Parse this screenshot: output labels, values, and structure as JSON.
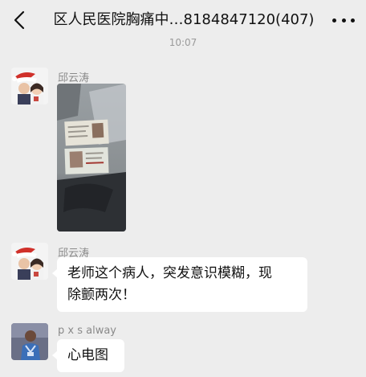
{
  "header": {
    "title": "区人民医院胸痛中…8184847120(407)"
  },
  "chat": {
    "timestamp": "10:07",
    "messages": [
      {
        "sender": "邱云涛",
        "type": "image"
      },
      {
        "sender": "邱云涛",
        "type": "text",
        "text_line1": "老师这个病人，突发意识模糊，现",
        "text_line2": "除颤两次！"
      },
      {
        "sender": "p x s alway",
        "type": "text",
        "text": "心电图"
      }
    ]
  },
  "colors": {
    "background": "#ededed",
    "bubble": "#ffffff",
    "sender_text": "#8a8a8a"
  }
}
